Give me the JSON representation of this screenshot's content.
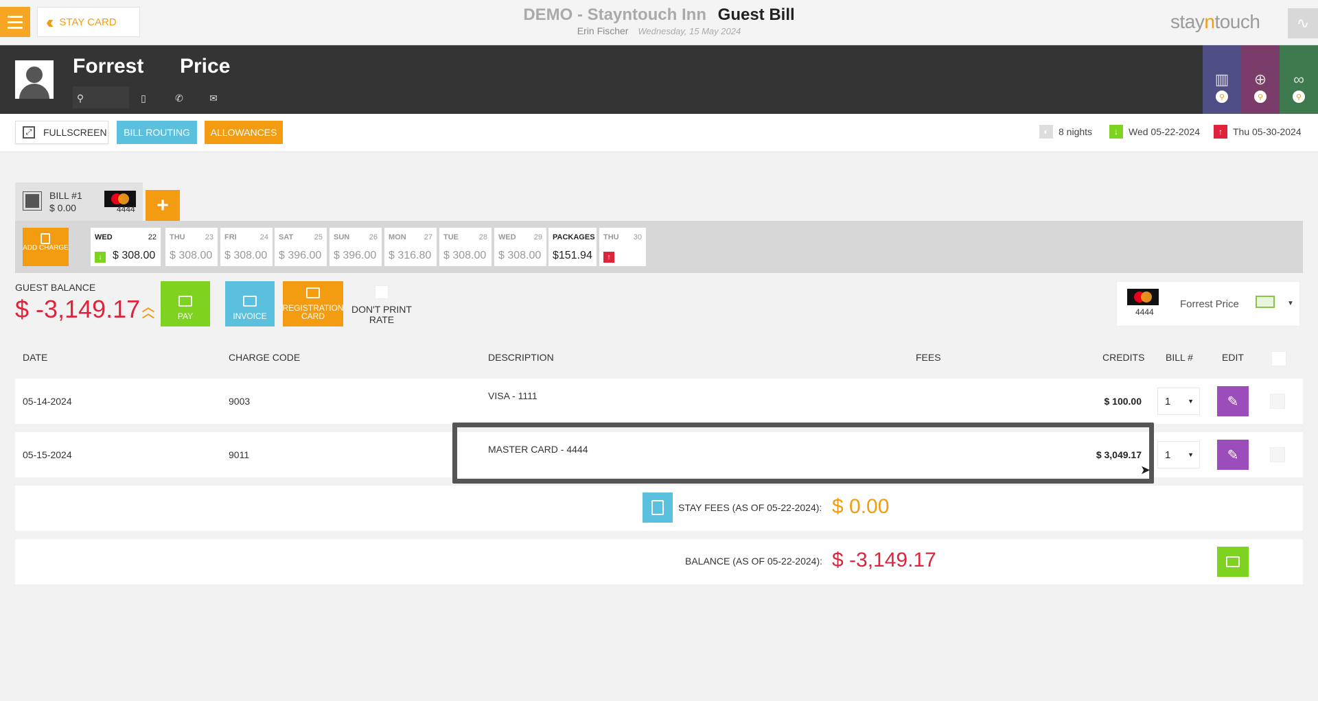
{
  "header": {
    "menu_icon": "hamburger-icon",
    "back_label": "STAY CARD",
    "hotel": "DEMO - Stayntouch Inn",
    "page_title": "Guest Bill",
    "user": "Erin Fischer",
    "date": "Wednesday, 15 May 2024",
    "brand_pre": "stay",
    "brand_mid": "n",
    "brand_post": "touch"
  },
  "guest": {
    "first_name": "Forrest",
    "last_name": "Price",
    "icons": [
      "location-pin-icon",
      "mobile-icon",
      "phone-icon",
      "email-icon"
    ],
    "tiles": [
      {
        "icon": "building-icon",
        "color": "#4f4f86"
      },
      {
        "icon": "globe-icon",
        "color": "#7a3d6a"
      },
      {
        "icon": "rings-icon",
        "color": "#3e7a4d"
      }
    ]
  },
  "actions": {
    "fullscreen": "FULLSCREEN",
    "bill_routing": "BILL ROUTING",
    "allowances": "ALLOWANCES",
    "nights": "8 nights",
    "arrival": "Wed 05-22-2024",
    "departure": "Thu 05-30-2024"
  },
  "bill_tab": {
    "label": "BILL #1",
    "amount": "$ 0.00",
    "card_last4": "4444",
    "add_label": "+"
  },
  "add_charge": "ADD CHARGE",
  "days": [
    {
      "name": "WED",
      "num": "22",
      "amount": "$ 308.00",
      "active": true,
      "arrow": "down"
    },
    {
      "name": "THU",
      "num": "23",
      "amount": "$ 308.00"
    },
    {
      "name": "FRI",
      "num": "24",
      "amount": "$ 308.00"
    },
    {
      "name": "SAT",
      "num": "25",
      "amount": "$ 396.00"
    },
    {
      "name": "SUN",
      "num": "26",
      "amount": "$ 396.00"
    },
    {
      "name": "MON",
      "num": "27",
      "amount": "$ 316.80"
    },
    {
      "name": "TUE",
      "num": "28",
      "amount": "$ 308.00"
    },
    {
      "name": "WED",
      "num": "29",
      "amount": "$ 308.00"
    },
    {
      "name": "PACKAGES",
      "num": "",
      "amount": "$151.94",
      "active": true
    },
    {
      "name": "THU",
      "num": "30",
      "amount": "",
      "arrow": "up"
    }
  ],
  "balance": {
    "label": "GUEST BALANCE",
    "value": "$ -3,149.17",
    "pay": "PAY",
    "invoice": "INVOICE",
    "registration": "REGISTRATION CARD",
    "dont_print": "DON'T PRINT RATE"
  },
  "payment_card": {
    "last4": "4444",
    "holder": "Forrest Price"
  },
  "table": {
    "headers": {
      "date": "DATE",
      "charge_code": "CHARGE CODE",
      "description": "DESCRIPTION",
      "fees": "FEES",
      "credits": "CREDITS",
      "bill": "BILL #",
      "edit": "EDIT"
    },
    "rows": [
      {
        "date": "05-14-2024",
        "code": "9003",
        "description": "VISA - 1111",
        "credit": "$ 100.00",
        "bill": "1"
      },
      {
        "date": "05-15-2024",
        "code": "9011",
        "description": "MASTER CARD - 4444",
        "credit": "$ 3,049.17",
        "bill": "1"
      }
    ]
  },
  "summary": {
    "stay_fees_label": "STAY FEES (AS OF",
    "stay_fees_date": "05-22-2024",
    "stay_fees_suffix": "):",
    "stay_fees_value": "$ 0.00",
    "balance_label": "BALANCE (AS OF",
    "balance_date": "05-22-2024",
    "balance_suffix": "):",
    "balance_value": "$ -3,149.17"
  },
  "colors": {
    "accent": "#f39c12",
    "negative": "#e0233c",
    "info": "#5bc0de",
    "edit": "#9b4dba",
    "success": "#7ed321"
  }
}
